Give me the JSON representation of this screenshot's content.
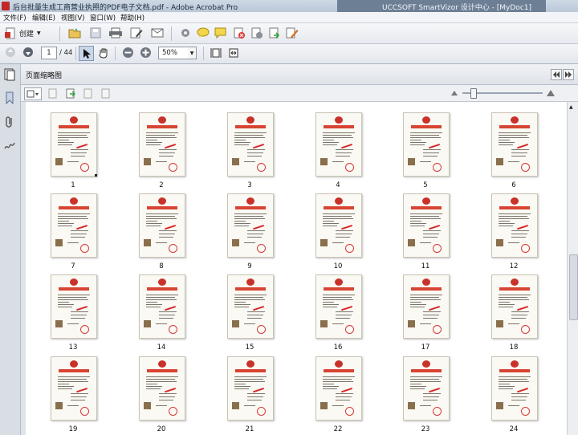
{
  "window": {
    "title": "后台批量生成工商营业执照的PDF电子文档.pdf - Adobe Acrobat Pro",
    "extension_title": "UCCSOFT SmartVizor 设计中心 - [MyDoc1]"
  },
  "menu": {
    "items": [
      "文件(F)",
      "编辑(E)",
      "视图(V)",
      "窗口(W)",
      "帮助(H)"
    ]
  },
  "toolbar": {
    "create_label": "创建",
    "icons": [
      "open-folder-icon",
      "save-icon",
      "print-icon",
      "edit-icon",
      "email-icon",
      "settings-icon",
      "comment-icon",
      "sticky-note-icon",
      "delete-page-icon",
      "insert-page-icon",
      "extract-page-icon",
      "sign-icon"
    ]
  },
  "navigation": {
    "current_page": "1",
    "total_pages": "/ 44",
    "zoom": "50%"
  },
  "panel": {
    "title": "页面缩略图"
  },
  "thumbnails": {
    "doc_title": "企业营业执照",
    "pages": [
      "1",
      "2",
      "3",
      "4",
      "5",
      "6",
      "7",
      "8",
      "9",
      "10",
      "11",
      "12",
      "13",
      "14",
      "15",
      "16",
      "17",
      "18",
      "19",
      "20",
      "21",
      "22",
      "23",
      "24"
    ]
  },
  "colors": {
    "accent_red": "#c8322a",
    "workspace_bg": "#ffffff"
  }
}
